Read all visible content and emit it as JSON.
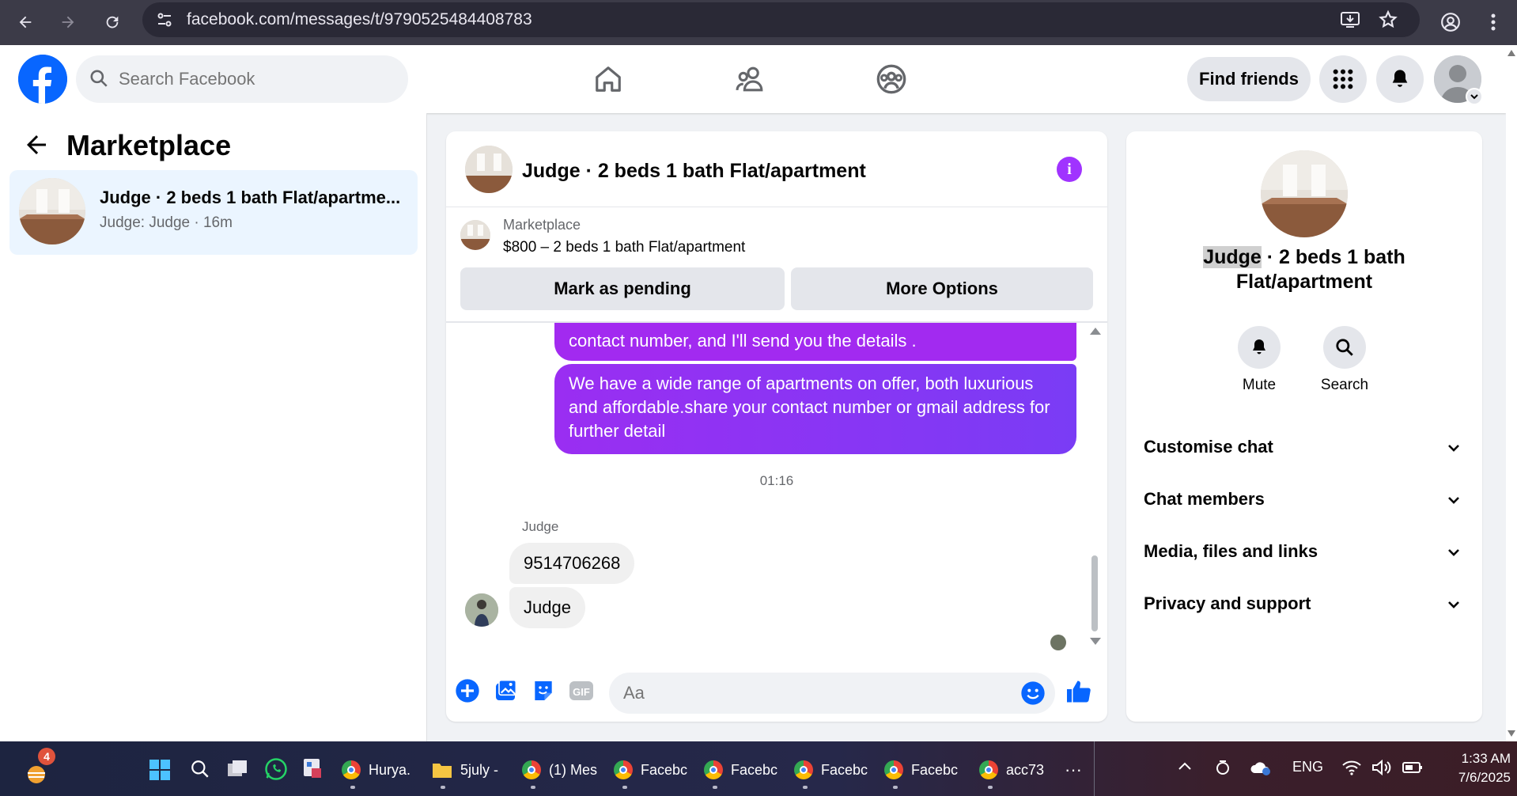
{
  "browser": {
    "url": "facebook.com/messages/t/9790525484408783"
  },
  "header": {
    "search_placeholder": "Search Facebook",
    "find_friends_label": "Find friends"
  },
  "sidebar": {
    "title": "Marketplace",
    "conversation": {
      "name": "Judge · 2 beds 1 bath Flat/apartme...",
      "subtitle": "Judge: Judge · 16m"
    }
  },
  "chat": {
    "title": "Judge · 2 beds 1 bath Flat/apartment",
    "listing": {
      "label": "Marketplace",
      "price_line": "$800 – 2 beds 1 bath Flat/apartment"
    },
    "actions": {
      "mark_pending": "Mark as pending",
      "more_options": "More Options"
    },
    "messages": {
      "out1": "contact number, and I'll send you the details .",
      "out2": "We have a wide range of apartments on offer, both luxurious and affordable.share your contact number or gmail address for further detail",
      "timestamp": "01:16",
      "sender": "Judge",
      "in1": "9514706268",
      "in2": "Judge"
    },
    "composer_placeholder": "Aa"
  },
  "info_panel": {
    "title_highlight": "Judge",
    "title_rest": " · 2 beds 1 bath Flat/apartment",
    "mute_label": "Mute",
    "search_label": "Search",
    "sections": [
      "Customise chat",
      "Chat members",
      "Media, files and links",
      "Privacy and support"
    ]
  },
  "taskbar": {
    "badge_count": "4",
    "apps": [
      "Hurya.",
      "5july -",
      "(1) Mes",
      "Facebc",
      "Facebc",
      "Facebc",
      "Facebc",
      "acc73"
    ],
    "more": "···",
    "language": "ENG",
    "time": "1:33 AM",
    "date": "7/6/2025"
  },
  "colors": {
    "fb_blue": "#0866ff",
    "messenger_purple": "#a033ff",
    "bubble_in": "#f0f0f0"
  }
}
